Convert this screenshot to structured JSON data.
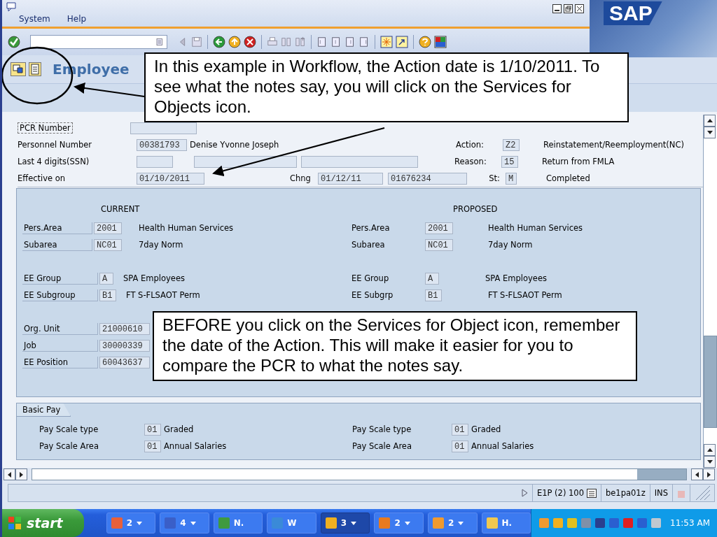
{
  "menu": [
    "System",
    "Help"
  ],
  "logo": "SAP",
  "title": "Employee",
  "header": {
    "pcr_label": "PCR Number",
    "personnel": {
      "label": "Personnel Number",
      "value": "00381793",
      "name": "Denise Yvonne Joseph"
    },
    "ssn": {
      "label": "Last 4 digits(SSN)"
    },
    "effective": {
      "label": "Effective on",
      "value": "01/10/2011",
      "change_label": "Chng",
      "change_date": "01/12/11",
      "change_number": "01676234",
      "status_label": "St:",
      "status": "M",
      "status_text": "Completed"
    },
    "action": {
      "label": "Action:",
      "code": "Z2",
      "text": "Reinstatement/Reemployment(NC)"
    },
    "reason": {
      "label": "Reason:",
      "code": "15",
      "text": "Return from FMLA"
    }
  },
  "current": {
    "heading": "CURRENT",
    "groups": [
      [
        {
          "label": "Pers.Area",
          "code": "2001",
          "text": "Health Human Services"
        },
        {
          "label": "Subarea",
          "code": "NC01",
          "text": "7day Norm"
        }
      ],
      [
        {
          "label": "EE Group",
          "code": "A",
          "text": "SPA Employees"
        },
        {
          "label": "EE Subgroup",
          "code": "B1",
          "text": "FT S-FLSAOT Perm"
        }
      ],
      [
        {
          "label": "Org. Unit",
          "code": "21000610"
        },
        {
          "label": "Job",
          "code": "30000339"
        },
        {
          "label": "EE Position",
          "code": "60043637"
        }
      ]
    ]
  },
  "proposed": {
    "heading": "PROPOSED",
    "groups": [
      [
        {
          "label": "Pers.Area",
          "code": "2001",
          "text": "Health Human Services"
        },
        {
          "label": "Subarea",
          "code": "NC01",
          "text": "7day Norm"
        }
      ],
      [
        {
          "label": "EE Group",
          "code": "A",
          "text": "SPA Employees"
        },
        {
          "label": "EE Subgrp",
          "code": "B1",
          "text": "FT S-FLSAOT Perm"
        }
      ]
    ]
  },
  "basic_pay": {
    "tab": "Basic Pay",
    "left": [
      {
        "label": "Pay Scale type",
        "code": "01",
        "text": "Graded"
      },
      {
        "label": "Pay Scale Area",
        "code": "01",
        "text": "Annual Salaries"
      }
    ],
    "right": [
      {
        "label": "Pay Scale type",
        "code": "01",
        "text": "Graded"
      },
      {
        "label": "Pay Scale Area",
        "code": "01",
        "text": "Annual Salaries"
      }
    ]
  },
  "status_bar": {
    "system": "E1P (2) 100",
    "server": "be1pa01z",
    "mode": "INS"
  },
  "callouts": [
    "In this example in Workflow, the Action date is 1/10/2011. To see what the notes say, you will click on the Services for Objects icon.",
    "BEFORE you click on the Services for Object icon, remember the date of the Action.  This will make it easier for you to compare the PCR to what the notes say."
  ],
  "taskbar": {
    "start": "start",
    "buttons": [
      {
        "kind": "group",
        "label": "2",
        "color": "#e8603a",
        "selected": false
      },
      {
        "kind": "group",
        "label": "4",
        "color": "#3a5fc8",
        "selected": false
      },
      {
        "kind": "window",
        "label": "N.",
        "color": "#3f9a3f",
        "selected": false
      },
      {
        "kind": "window",
        "label": "W",
        "color": "#3a8ad8",
        "selected": false
      },
      {
        "kind": "group",
        "label": "3",
        "color": "#f0b020",
        "selected": true
      },
      {
        "kind": "group",
        "label": "2",
        "color": "#e87a20",
        "selected": false
      },
      {
        "kind": "group",
        "label": "2",
        "color": "#f09a30",
        "selected": false
      },
      {
        "kind": "window",
        "label": "H.",
        "color": "#f0c850",
        "selected": false
      }
    ],
    "clock": "11:53 AM"
  }
}
